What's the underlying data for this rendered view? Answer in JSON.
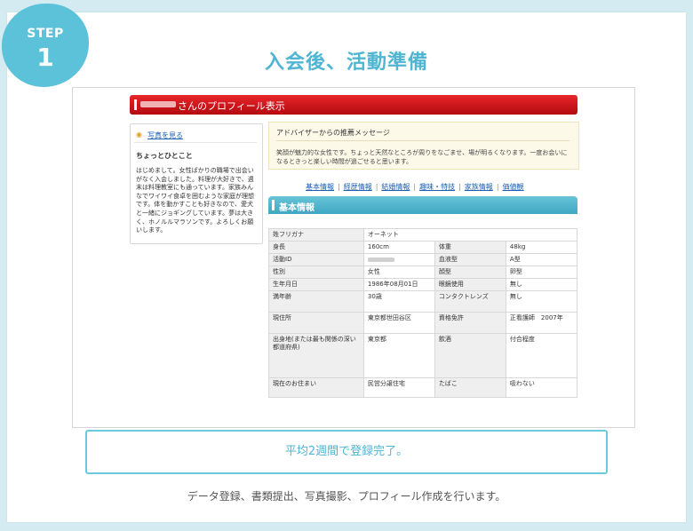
{
  "step": {
    "label": "STEP",
    "number": "1"
  },
  "title": "入会後、活動準備",
  "profile": {
    "header_suffix": "さんのプロフィール表示",
    "photo_link": "写真を見る",
    "hitokoto_title": "ちょっとひとこと",
    "hitokoto_body": "はじめまして。女性ばかりの職場で出会いがなく入会しました。料理が大好きで、週末は料理教室にも通っています。家族みんなでワイワイ食卓を囲むような家庭が理想です。体を動かすことも好きなので、愛犬と一緒にジョギングしています。夢は大きく、ホノルルマラソンです。よろしくお願いします。",
    "advisor_title": "アドバイザーからの推薦メッセージ",
    "advisor_body": "笑顔が魅力的な女性です。ちょっと天然なところが周りをなごませ、場が明るくなります。一度お会いになるときっと楽しい時間が過ごせると思います。",
    "tabs": [
      "基本情報",
      "経歴情報",
      "結婚情報",
      "趣味・特技",
      "家族情報",
      "価値観"
    ],
    "basic_header": "基本情報",
    "rows": [
      {
        "k1": "姓フリガナ",
        "v1": "オーネット",
        "k2": "",
        "v2": ""
      },
      {
        "k1": "身長",
        "v1": "160cm",
        "k2": "体重",
        "v2": "48kg"
      },
      {
        "k1": "活動ID",
        "v1": "",
        "k2": "血液型",
        "v2": "A型"
      },
      {
        "k1": "性別",
        "v1": "女性",
        "k2": "顔型",
        "v2": "卵型"
      },
      {
        "k1": "生年月日",
        "v1": "1986年08月01日",
        "k2": "眼鏡使用",
        "v2": "無し"
      },
      {
        "k1": "満年齢",
        "v1": "30歳",
        "k2": "コンタクトレンズ",
        "v2": "無し"
      },
      {
        "k1": "現住所",
        "v1": "東京都世田谷区",
        "k2": "資格免許",
        "v2": "正看護師　2007年"
      },
      {
        "k1": "出身地(または最も関係の深い都道府県)",
        "v1": "東京都",
        "k2": "飲酒",
        "v2": "付合程度"
      },
      {
        "k1": "現在のお住まい",
        "v1": "民営分譲住宅",
        "k2": "たばこ",
        "v2": "吸わない"
      }
    ]
  },
  "done_message": "平均2週間で登録完了。",
  "footer_note": "データ登録、書類提出、写真撮影、プロフィール作成を行います。"
}
